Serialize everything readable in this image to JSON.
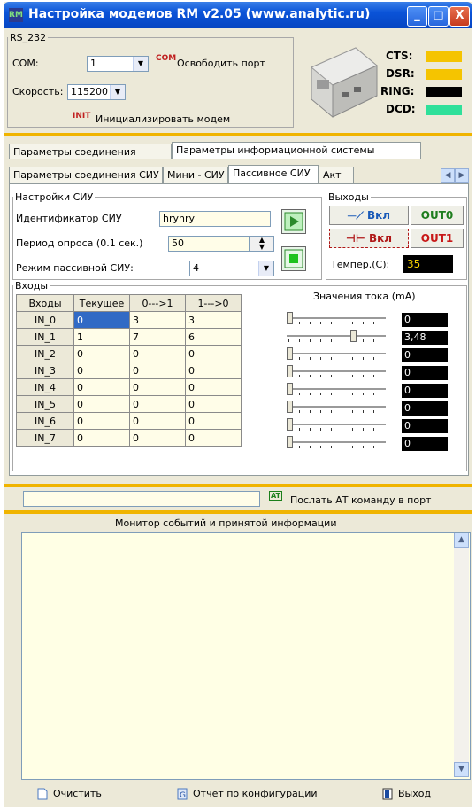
{
  "window": {
    "title": "Настройка модемов RM v2.05 (www.analytic.ru)",
    "app_icon": "RM",
    "buttons": [
      "_",
      "□",
      "X"
    ]
  },
  "rs232": {
    "legend": "RS_232",
    "com_label": "COM:",
    "com_value": "1",
    "release_port_icon": "COM",
    "release_port_label": "Освободить порт",
    "speed_label": "Скорость:",
    "speed_value": "115200",
    "init_icon": "INIT",
    "init_label": "Инициализировать модем"
  },
  "signals": [
    {
      "label": "CTS:",
      "color": "#f5c400"
    },
    {
      "label": "DSR:",
      "color": "#f5c400"
    },
    {
      "label": "RING:",
      "color": "#000000"
    },
    {
      "label": "DCD:",
      "color": "#2fe09a"
    }
  ],
  "tabs_main": [
    "Параметры соединения",
    "Параметры информационной системы"
  ],
  "tabs_sub": [
    "Параметры соединения СИУ",
    "Мини - СИУ",
    "Пассивное СИУ",
    "Акт"
  ],
  "siu": {
    "legend": "Настройки СИУ",
    "id_label": "Идентификатор СИУ",
    "id_value": "hryhry",
    "period_label": "Период опроса (0.1 сек.)",
    "period_value": "50",
    "mode_label": "Режим пассивной СИУ:",
    "mode_value": "4"
  },
  "outputs": {
    "legend": "Выходы",
    "out0_state": "Вкл",
    "out0_label": "OUT0",
    "out1_state": "Вкл",
    "out1_label": "OUT1",
    "temp_label": "Темпер.(C):",
    "temp_value": "35"
  },
  "inputs": {
    "legend": "Входы",
    "headers": [
      "Входы",
      "Текущее",
      "0--->1",
      "1--->0"
    ],
    "rows": [
      [
        "IN_0",
        "0",
        "3",
        "3"
      ],
      [
        "IN_1",
        "1",
        "7",
        "6"
      ],
      [
        "IN_2",
        "0",
        "0",
        "0"
      ],
      [
        "IN_3",
        "0",
        "0",
        "0"
      ],
      [
        "IN_4",
        "0",
        "0",
        "0"
      ],
      [
        "IN_5",
        "0",
        "0",
        "0"
      ],
      [
        "IN_6",
        "0",
        "0",
        "0"
      ],
      [
        "IN_7",
        "0",
        "0",
        "0"
      ]
    ],
    "current_label": "Значения тока  (mA)",
    "current_values": [
      "0",
      "3,48",
      "0",
      "0",
      "0",
      "0",
      "0",
      "0"
    ],
    "slider_fractions": [
      0,
      0.68,
      0,
      0,
      0,
      0,
      0,
      0
    ]
  },
  "at": {
    "input_value": "",
    "icon": "AT",
    "send_label": "Послать АТ команду в порт"
  },
  "monitor": {
    "title": "Монитор событий и  принятой информации"
  },
  "footer": {
    "clear_label": "Очистить",
    "report_label": "Отчет по конфигурации",
    "exit_label": "Выход"
  }
}
